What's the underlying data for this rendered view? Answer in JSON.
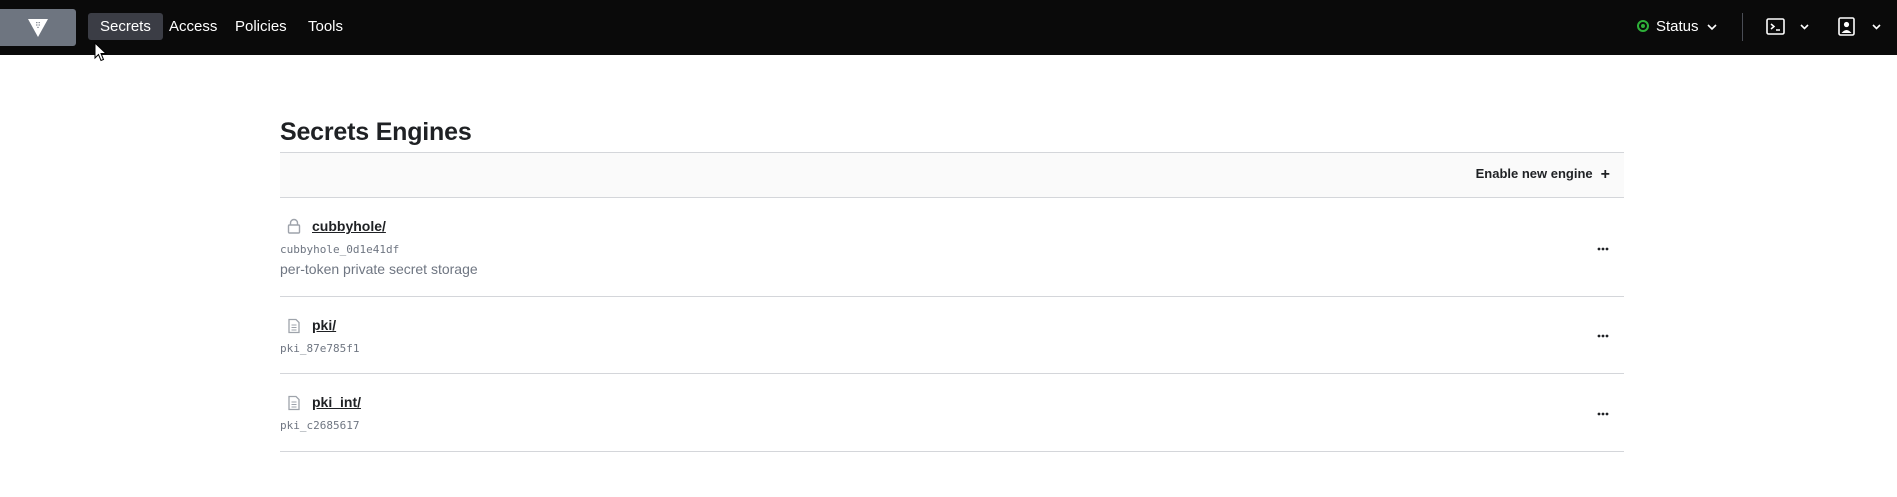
{
  "nav": {
    "items": [
      {
        "label": "Secrets",
        "active": true
      },
      {
        "label": "Access",
        "active": false
      },
      {
        "label": "Policies",
        "active": false
      },
      {
        "label": "Tools",
        "active": false
      }
    ],
    "status_label": "Status",
    "status_color": "#2eb039",
    "icons": [
      "vault-logo-icon",
      "status-dot-icon",
      "chevron-down-icon",
      "terminal-icon",
      "user-icon"
    ]
  },
  "page": {
    "title": "Secrets Engines",
    "enable_label": "Enable new engine",
    "enable_icon": "+"
  },
  "engines": [
    {
      "path": "cubbyhole/",
      "accessor": "cubbyhole_0d1e41df",
      "description": "per-token private secret storage",
      "icon": "lock-icon"
    },
    {
      "path": "pki/",
      "accessor": "pki_87e785f1",
      "description": "",
      "icon": "file-icon"
    },
    {
      "path": "pki_int/",
      "accessor": "pki_c2685617",
      "description": "",
      "icon": "file-icon"
    }
  ],
  "colors": {
    "topbar": "#0a0a0a",
    "active_nav": "#3b3d45",
    "logo_bg": "#6e7580",
    "border": "#d4d6da"
  }
}
